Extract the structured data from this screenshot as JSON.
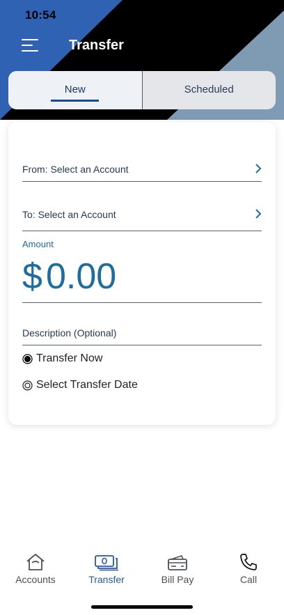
{
  "status_bar": {
    "time": "10:54"
  },
  "header": {
    "title": "Transfer",
    "menu_icon": "hamburger-menu-icon"
  },
  "tabs": [
    {
      "label": "New",
      "active": true
    },
    {
      "label": "Scheduled",
      "active": false
    }
  ],
  "form": {
    "from": "From: Select an Account",
    "to": "To: Select an Account",
    "amount_label": "Amount",
    "currency_symbol": "$",
    "amount_value": "0.00",
    "description_placeholder": "Description (Optional)",
    "options": [
      {
        "label": "Transfer Now",
        "selected": true
      },
      {
        "label": "Select Transfer Date",
        "selected": false
      }
    ]
  },
  "nav": [
    {
      "label": "Accounts",
      "icon": "home-icon",
      "active": false
    },
    {
      "label": "Transfer",
      "icon": "money-transfer-icon",
      "active": true
    },
    {
      "label": "Bill Pay",
      "icon": "credit-card-icon",
      "active": false
    },
    {
      "label": "Call",
      "icon": "phone-icon",
      "active": false
    }
  ],
  "colors": {
    "header_blue": "#2f62b3",
    "header_light": "#7f9ab3",
    "accent": "#1d6d9e",
    "active_nav": "#2458a8"
  }
}
